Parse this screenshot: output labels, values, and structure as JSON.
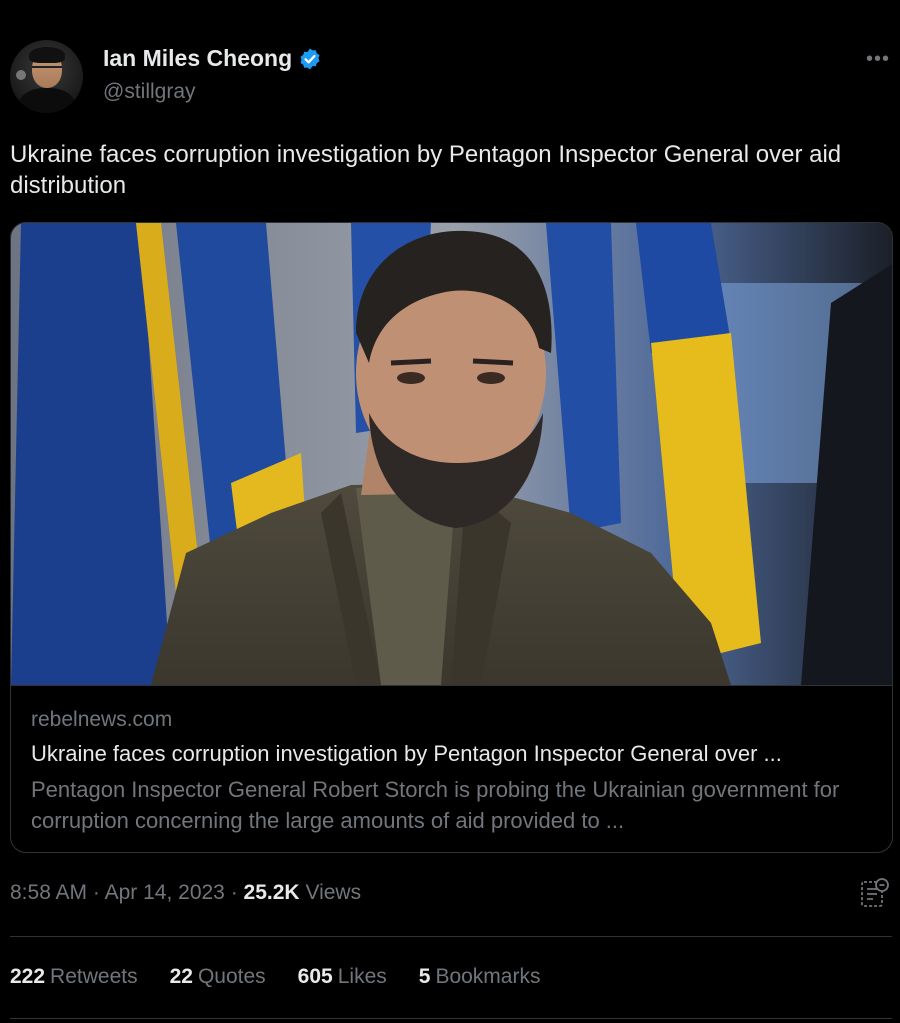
{
  "author": {
    "display_name": "Ian Miles Cheong",
    "handle": "@stillgray",
    "verified": true
  },
  "tweet": {
    "text": "Ukraine faces corruption investigation by Pentagon Inspector General over aid distribution"
  },
  "card": {
    "domain": "rebelnews.com",
    "title": "Ukraine faces corruption investigation by Pentagon Inspector General over ...",
    "description": "Pentagon Inspector General Robert Storch is probing the Ukrainian government for corruption concerning the large amounts of aid provided to ..."
  },
  "meta": {
    "time": "8:58 AM",
    "separator": "·",
    "date": "Apr 14, 2023",
    "views_count": "25.2K",
    "views_label": "Views"
  },
  "stats": {
    "retweets": {
      "count": "222",
      "label": "Retweets"
    },
    "quotes": {
      "count": "22",
      "label": "Quotes"
    },
    "likes": {
      "count": "605",
      "label": "Likes"
    },
    "bookmarks": {
      "count": "5",
      "label": "Bookmarks"
    }
  },
  "icons": {
    "verified": "verified-badge-icon",
    "more": "more-options-icon",
    "analytics": "analytics-icon"
  },
  "colors": {
    "background": "#000000",
    "text_primary": "#e7e9ea",
    "text_secondary": "#71767b",
    "border": "#2f3336",
    "verified_blue": "#1d9bf0",
    "flag_blue": "#1f4fa8",
    "flag_yellow": "#e3b716"
  }
}
